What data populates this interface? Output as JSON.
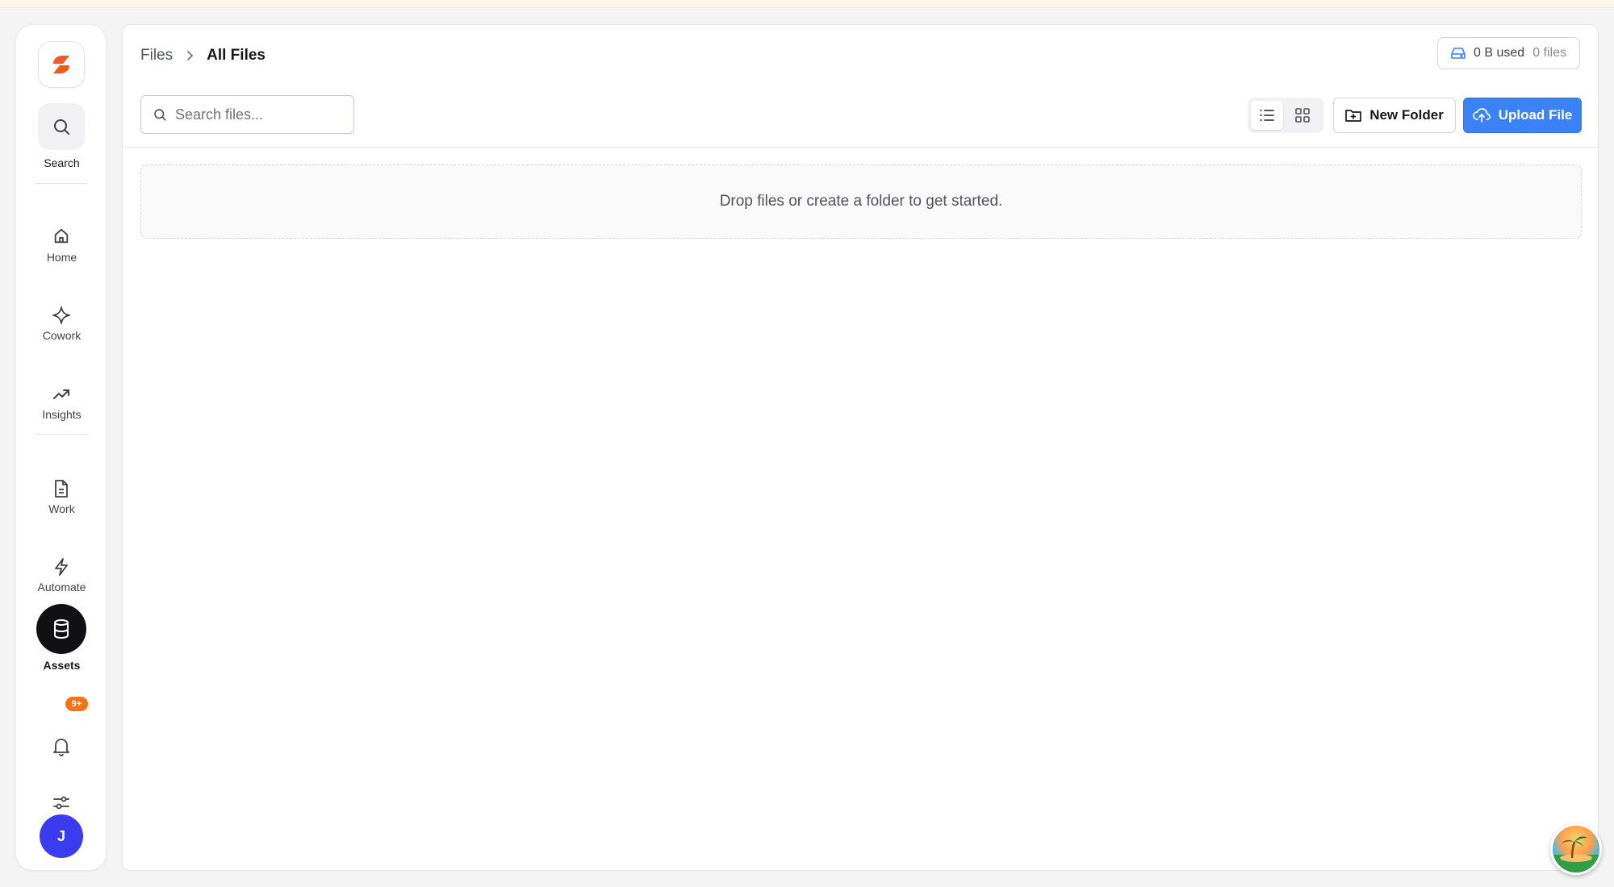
{
  "sidebar": {
    "search_label": "Search",
    "items": [
      {
        "label": "Home",
        "icon": "home-icon"
      },
      {
        "label": "Cowork",
        "icon": "sparkle-icon"
      },
      {
        "label": "Insights",
        "icon": "trending-up-icon"
      },
      {
        "label": "Work",
        "icon": "document-icon"
      },
      {
        "label": "Automate",
        "icon": "lightning-icon"
      },
      {
        "label": "Assets",
        "icon": "database-icon",
        "active": true
      }
    ],
    "notifications_badge": "9+",
    "avatar_initial": "J"
  },
  "breadcrumb": {
    "root": "Files",
    "current": "All Files"
  },
  "usage": {
    "used": "0 B used",
    "files": "0 files"
  },
  "search": {
    "placeholder": "Search files..."
  },
  "toolbar": {
    "new_folder_label": "New Folder",
    "upload_label": "Upload File",
    "view_mode": "list"
  },
  "empty_state": {
    "message": "Drop files or create a folder to get started."
  },
  "colors": {
    "accent": "#3b82f6",
    "brand": "#f15a24",
    "badge": "#f97316",
    "avatar": "#3b3bf0"
  }
}
